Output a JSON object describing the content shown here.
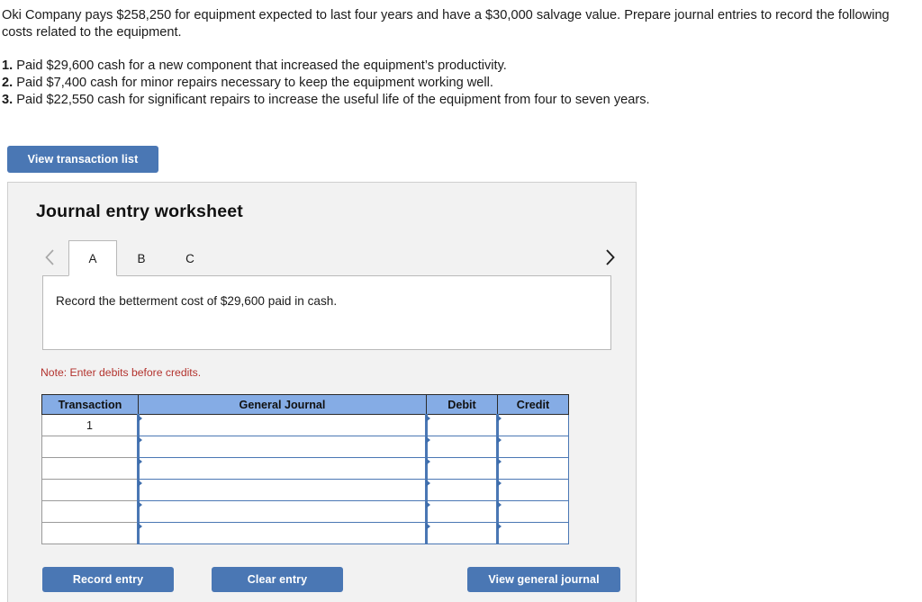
{
  "problem": {
    "intro": "Oki Company pays $258,250 for equipment expected to last four years and have a $30,000 salvage value. Prepare journal entries to record the following costs related to the equipment.",
    "items": [
      {
        "number": "1.",
        "text": "Paid $29,600 cash for a new component that increased the equipment’s productivity."
      },
      {
        "number": "2.",
        "text": "Paid $7,400 cash for minor repairs necessary to keep the equipment working well."
      },
      {
        "number": "3.",
        "text": "Paid $22,550 cash for significant repairs to increase the useful life of the equipment from four to seven years."
      }
    ]
  },
  "toolbar": {
    "view_transaction_list_label": "View transaction list"
  },
  "worksheet": {
    "title": "Journal entry worksheet",
    "tabs": [
      {
        "label": "A",
        "active": true
      },
      {
        "label": "B",
        "active": false
      },
      {
        "label": "C",
        "active": false
      }
    ],
    "nav": {
      "prev_icon": "chevron-left-icon",
      "next_icon": "chevron-right-icon"
    },
    "prompt": "Record the betterment cost of $29,600 paid in cash.",
    "note": "Note: Enter debits before credits.",
    "table": {
      "headers": [
        "Transaction",
        "General Journal",
        "Debit",
        "Credit"
      ],
      "rows": [
        {
          "transaction": "1",
          "general_journal": "",
          "debit": "",
          "credit": ""
        },
        {
          "transaction": "",
          "general_journal": "",
          "debit": "",
          "credit": ""
        },
        {
          "transaction": "",
          "general_journal": "",
          "debit": "",
          "credit": ""
        },
        {
          "transaction": "",
          "general_journal": "",
          "debit": "",
          "credit": ""
        },
        {
          "transaction": "",
          "general_journal": "",
          "debit": "",
          "credit": ""
        },
        {
          "transaction": "",
          "general_journal": "",
          "debit": "",
          "credit": ""
        }
      ]
    },
    "buttons": {
      "record_entry": "Record entry",
      "clear_entry": "Clear entry",
      "view_general_journal": "View general journal"
    }
  },
  "colors": {
    "button_blue": "#4a77b4",
    "table_header_blue": "#85ace5",
    "note_red": "#b3332e",
    "panel_gray": "#f2f2f2",
    "cell_border_blue": "#4a77b4"
  }
}
